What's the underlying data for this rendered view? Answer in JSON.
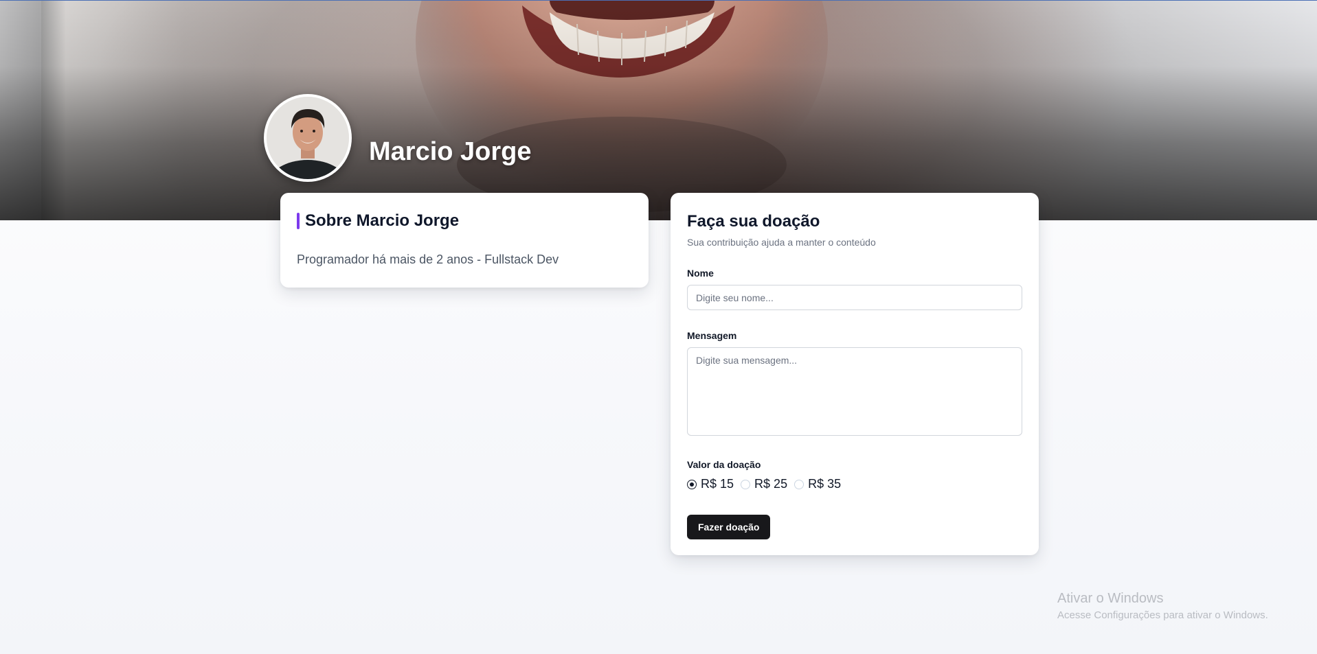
{
  "profile": {
    "name": "Marcio Jorge"
  },
  "about": {
    "title": "Sobre Marcio Jorge",
    "text": "Programador há mais de 2 anos - Fullstack Dev"
  },
  "donation": {
    "title": "Faça sua doação",
    "subtitle": "Sua contribuição ajuda a manter o conteúdo",
    "name_label": "Nome",
    "name_placeholder": "Digite seu nome...",
    "message_label": "Mensagem",
    "message_placeholder": "Digite sua mensagem...",
    "amount_label": "Valor da doação",
    "amounts": [
      {
        "label": "R$ 15",
        "selected": true
      },
      {
        "label": "R$ 25",
        "selected": false
      },
      {
        "label": "R$ 35",
        "selected": false
      }
    ],
    "submit_label": "Fazer doação"
  },
  "windows_watermark": {
    "title": "Ativar o Windows",
    "subtitle": "Acesse Configurações para ativar o Windows."
  },
  "colors": {
    "accent": "#7c3aed",
    "button": "#18181b"
  },
  "icons": {
    "hero": "cover-photo",
    "avatar": "user-photo"
  }
}
